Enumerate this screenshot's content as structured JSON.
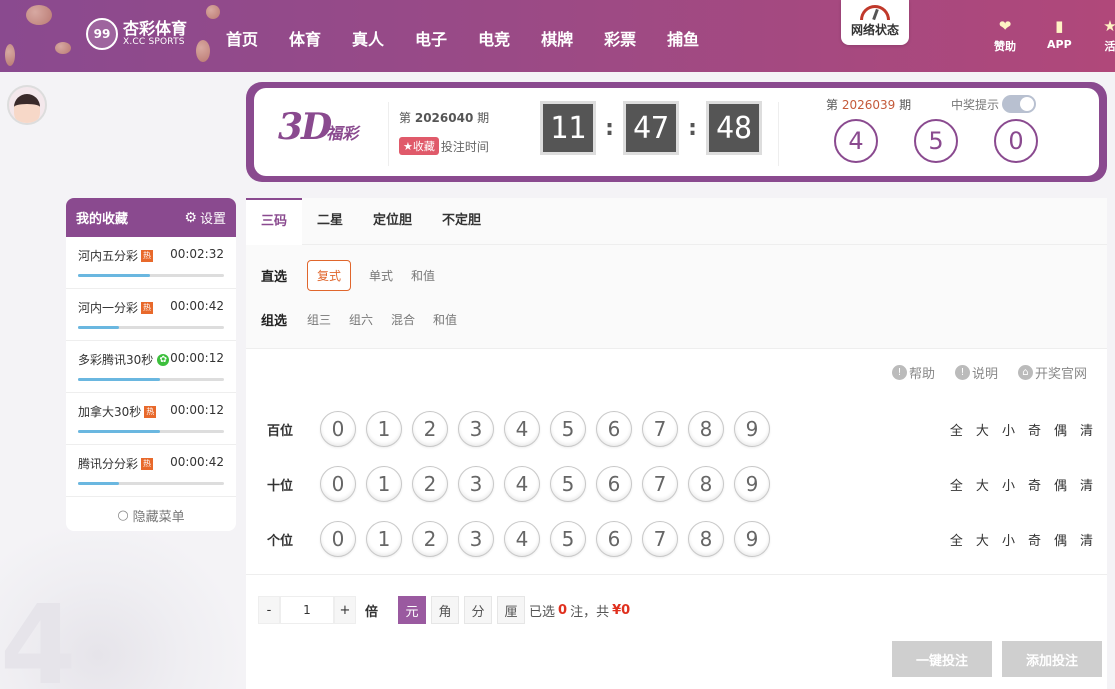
{
  "header": {
    "logo_cn": "杏彩体育",
    "logo_en": "X.CC SPORTS",
    "logo_mark": "99",
    "nav": [
      "首页",
      "体育",
      "真人",
      "电子",
      "电竞",
      "棋牌",
      "彩票",
      "捕鱼"
    ],
    "network_status": "网络状态",
    "right_items": [
      {
        "label": "赞助",
        "icon": "handshake-icon"
      },
      {
        "label": "APP",
        "icon": "phone-icon"
      },
      {
        "label": "活",
        "icon": "gift-icon"
      }
    ]
  },
  "lottery": {
    "logo_main": "3D",
    "logo_sub": "福彩",
    "current_issue_prefix": "第",
    "current_issue": "2026040",
    "current_issue_suffix": "期",
    "fav_tag": "收藏",
    "bet_time_label": "投注时间",
    "countdown": {
      "h": "11",
      "m": "47",
      "s": "48"
    },
    "colon": ":",
    "prev_issue_prefix": "第",
    "prev_issue": "2026039",
    "prev_issue_suffix": "期",
    "remind_label": "中奖提示",
    "results": [
      "4",
      "5",
      "0"
    ]
  },
  "favorites": {
    "title": "我的收藏",
    "settings": "设置",
    "hot_badge": "热",
    "items": [
      {
        "name": "河内五分彩",
        "badge": "hot",
        "time": "00:02:32",
        "progress": 0.49
      },
      {
        "name": "河内一分彩",
        "badge": "hot",
        "time": "00:00:42",
        "progress": 0.28
      },
      {
        "name": "多彩腾讯30秒",
        "badge": "green",
        "time": "00:00:12",
        "progress": 0.56
      },
      {
        "name": "加拿大30秒",
        "badge": "hot",
        "time": "00:00:12",
        "progress": 0.56
      },
      {
        "name": "腾讯分分彩",
        "badge": "hot",
        "time": "00:00:42",
        "progress": 0.28
      }
    ],
    "hide_menu": "隐藏菜单"
  },
  "tabs": [
    "三码",
    "二星",
    "定位胆",
    "不定胆"
  ],
  "play_types": [
    {
      "label": "直选",
      "options": [
        "复式",
        "单式",
        "和值"
      ],
      "selected": 0
    },
    {
      "label": "组选",
      "options": [
        "组三",
        "组六",
        "混合",
        "和值"
      ],
      "selected": -1
    }
  ],
  "help_links": [
    "帮助",
    "说明",
    "开奖官网"
  ],
  "positions": [
    "百位",
    "十位",
    "个位"
  ],
  "numbers": [
    "0",
    "1",
    "2",
    "3",
    "4",
    "5",
    "6",
    "7",
    "8",
    "9"
  ],
  "quick_select": [
    "全",
    "大",
    "小",
    "奇",
    "偶",
    "清"
  ],
  "bet": {
    "minus": "-",
    "plus": "+",
    "multiplier": "1",
    "multiplier_unit": "倍",
    "units": [
      "元",
      "角",
      "分",
      "厘"
    ],
    "selected_unit": 0,
    "selected_prefix": "已选",
    "selected_count": "0",
    "selected_mid": "注，共",
    "total_amount": "¥0",
    "one_click": "一键投注",
    "add_bet": "添加投注"
  },
  "colors": {
    "brand": "#8a4a8f",
    "accent_orange": "#e0662c",
    "amount_red": "#e0301e",
    "hot_badge": "#e8692b"
  }
}
